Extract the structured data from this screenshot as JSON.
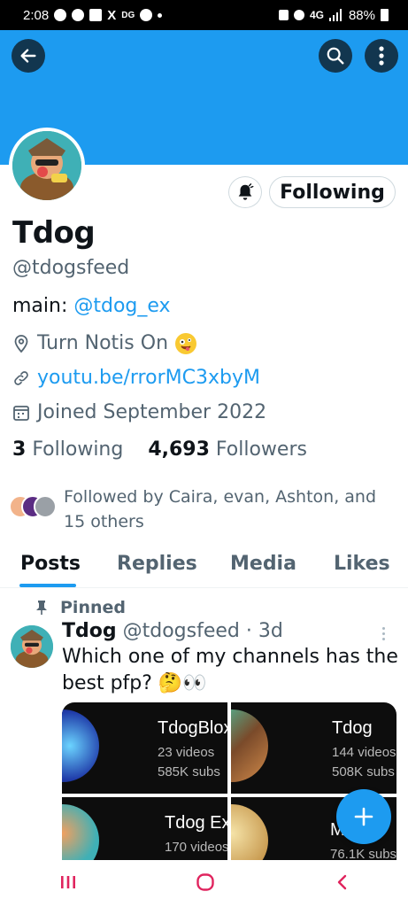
{
  "status_bar": {
    "time": "2:08",
    "x_icon": "X",
    "dg": "DG",
    "network": "4G",
    "battery": "88%"
  },
  "header": {
    "back_icon": "arrow-left-icon",
    "search_icon": "search-icon",
    "more_icon": "more-vertical-icon"
  },
  "colors": {
    "accent": "#1d9bf0",
    "banner": "#1d9bf0",
    "text": "#0f1419",
    "muted": "#536471"
  },
  "profile": {
    "follow_button": "Following",
    "name": "Tdog",
    "handle": "@tdogsfeed",
    "bio_prefix": "main: ",
    "bio_link": "@tdog_ex",
    "location": "Turn Notis On",
    "website": "youtu.be/rrorMC3xbyM",
    "joined": "Joined September 2022",
    "following_count": "3",
    "following_label": "Following",
    "followers_count": "4,693",
    "followers_label": "Followers",
    "followed_by": "Followed by Caira, evan, Ashton, and 15 others"
  },
  "tabs": [
    {
      "label": "Posts",
      "active": true
    },
    {
      "label": "Replies"
    },
    {
      "label": "Media"
    },
    {
      "label": "Likes"
    }
  ],
  "pinned_post": {
    "pinned_label": "Pinned",
    "author": "Tdog",
    "handle": "@tdogsfeed",
    "time": "· 3d",
    "text": "Which one of my channels has the best pfp? 🤔👀",
    "media": [
      {
        "title": "TdogBlox",
        "line1": "23 videos",
        "line2": "585K subs"
      },
      {
        "title": "Tdog",
        "line1": "144 videos",
        "line2": "508K subs"
      },
      {
        "title": "Tdog Ex",
        "line1": "170 videos",
        "line2": ""
      },
      {
        "title": "M",
        "line1": "76.1K subs",
        "line2": ""
      }
    ]
  },
  "fab_icon": "plus-icon",
  "nav": {
    "recents_icon": "recents-icon",
    "home_icon": "home-icon",
    "back_icon": "back-chevron-icon"
  }
}
